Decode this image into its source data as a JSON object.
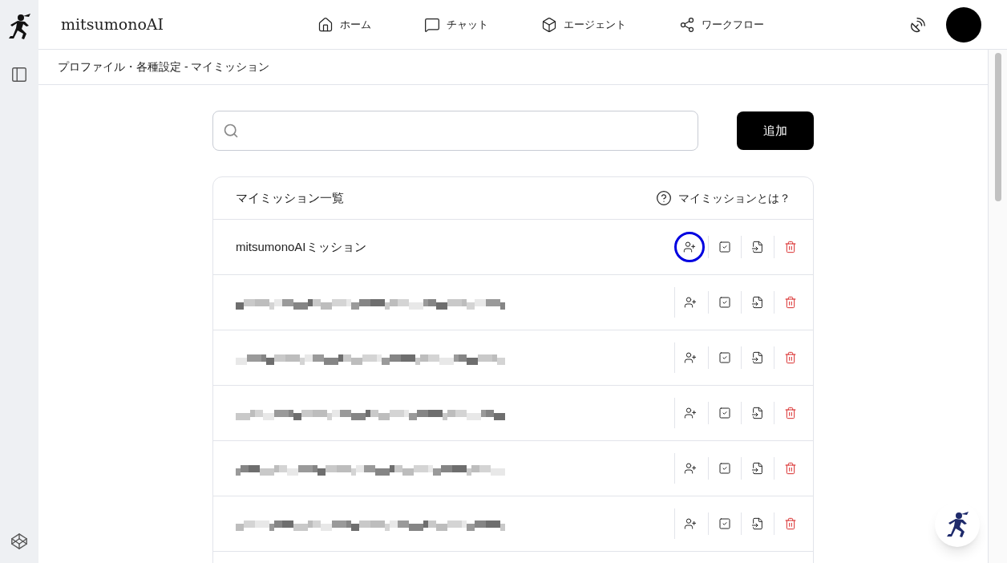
{
  "app": {
    "name": "mitsumonoAI"
  },
  "nav": [
    {
      "label": "ホーム",
      "kind": "home"
    },
    {
      "label": "チャット",
      "kind": "chat"
    },
    {
      "label": "エージェント",
      "kind": "agent"
    },
    {
      "label": "ワークフロー",
      "kind": "workflow"
    }
  ],
  "breadcrumb": "プロファイル・各種設定 - マイミッション",
  "add_button": "追加",
  "list": {
    "title": "マイミッション一覧",
    "help_link": "マイミッションとは？",
    "rows": [
      {
        "kind": "text",
        "name": "mitsumonoAIミッション",
        "highlighted": true
      },
      {
        "kind": "redacted",
        "highlighted": false
      },
      {
        "kind": "redacted",
        "highlighted": false
      },
      {
        "kind": "redacted",
        "highlighted": false
      },
      {
        "kind": "redacted",
        "highlighted": false
      },
      {
        "kind": "redacted",
        "highlighted": false
      }
    ]
  }
}
